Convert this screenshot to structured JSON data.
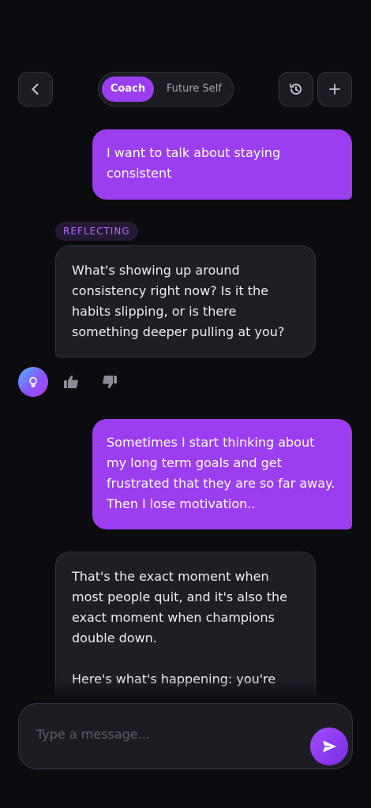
{
  "header": {
    "back_icon": "chevron-left-icon",
    "modes": [
      {
        "label": "Coach",
        "selected": true
      },
      {
        "label": "Future Self",
        "selected": false
      }
    ],
    "history_icon": "history-icon",
    "new_icon": "plus-icon"
  },
  "messages": {
    "user_1": "I want to talk about staying consistent",
    "tag": "REFLECTING",
    "coach_1": "What's showing up around consistency right now? Is it the habits slipping, or is there something deeper pulling at you?",
    "user_2": "Sometimes I start thinking about my long term goals and get frustrated that they are so far away. Then I lose motivation..",
    "coach_2": "That's the exact moment when most people quit, and it's also the exact moment when champions double down.\n\nHere's what's happening: you're"
  },
  "feedback": {
    "avatar_icon": "bulb-icon",
    "like_icon": "thumbs-up-icon",
    "dislike_icon": "thumbs-down-icon"
  },
  "composer": {
    "placeholder": "Type a message...",
    "value": "",
    "send_icon": "send-icon"
  },
  "colors": {
    "accent": "#9b3ef0",
    "background": "#0c0b0f",
    "surface": "#1f1e25",
    "tag_text": "#b56bff"
  }
}
